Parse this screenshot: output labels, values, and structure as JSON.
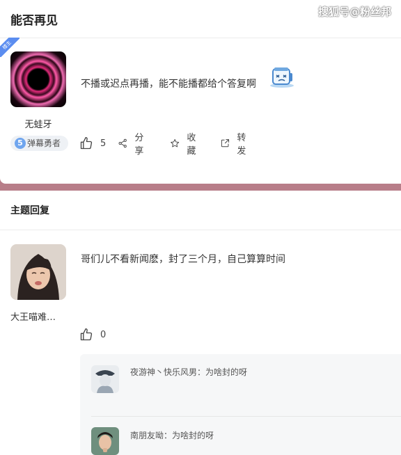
{
  "watermark": "搜狐号@粉丝邦",
  "post": {
    "title": "能否再见",
    "corner_badge": "楼主",
    "author": "无蛙牙",
    "level_number": "5",
    "level_label": "弹幕勇者",
    "content": "不播或迟点再播，能不能播都给个答复啊",
    "actions": {
      "like_count": "5",
      "share_label": "分享",
      "favorite_label": "收藏",
      "forward_label": "转发"
    }
  },
  "replies_section": {
    "title": "主题回复"
  },
  "reply": {
    "author": "大王喵难…",
    "content": "哥们儿不看新闻麽，封了三个月，自己算算时间",
    "like_count": "0",
    "sub_replies": [
      {
        "author": "夜游神丶快乐风男",
        "separator": "：",
        "content": "为啥封的呀"
      },
      {
        "author": "南朋友呦",
        "separator": "：",
        "content": "为啥封的呀"
      }
    ]
  },
  "colors": {
    "band": "#b87e89",
    "badge_blue": "#5b8df0"
  }
}
